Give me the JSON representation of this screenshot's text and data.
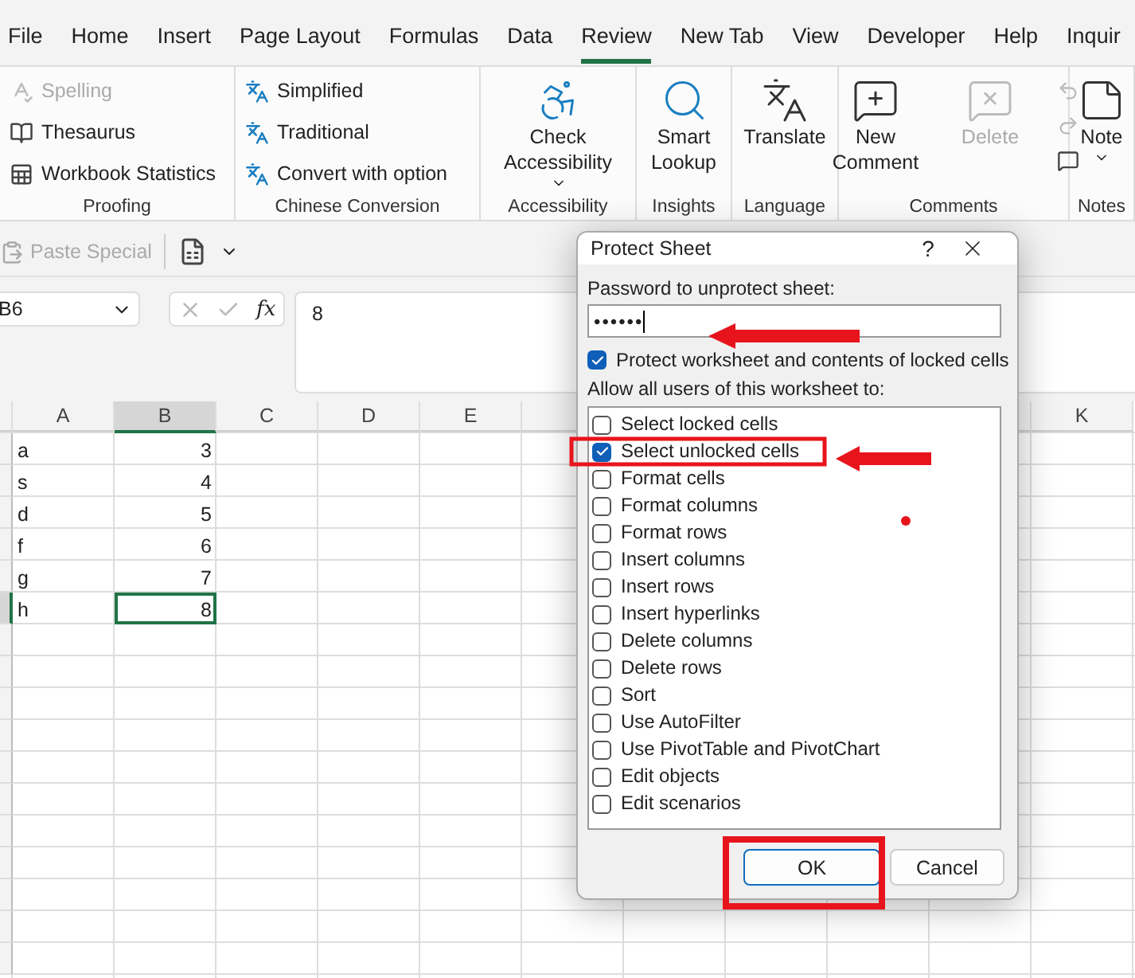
{
  "tabs": [
    {
      "label": "File",
      "selected": false
    },
    {
      "label": "Home",
      "selected": false
    },
    {
      "label": "Insert",
      "selected": false
    },
    {
      "label": "Page Layout",
      "selected": false
    },
    {
      "label": "Formulas",
      "selected": false
    },
    {
      "label": "Data",
      "selected": false
    },
    {
      "label": "Review",
      "selected": true
    },
    {
      "label": "New Tab",
      "selected": false
    },
    {
      "label": "View",
      "selected": false
    },
    {
      "label": "Developer",
      "selected": false
    },
    {
      "label": "Help",
      "selected": false
    },
    {
      "label": "Inquir",
      "selected": false
    }
  ],
  "ribbon": {
    "groups": [
      {
        "name": "Proofing",
        "kind": "list",
        "items": [
          {
            "label": "Spelling",
            "disabled": true
          },
          {
            "label": "Thesaurus",
            "disabled": false
          },
          {
            "label": "Workbook Statistics",
            "disabled": false
          }
        ]
      },
      {
        "name": "Chinese Conversion",
        "kind": "list",
        "items": [
          {
            "label": "Simplified",
            "disabled": false
          },
          {
            "label": "Traditional",
            "disabled": false
          },
          {
            "label": "Convert with option",
            "disabled": false
          }
        ]
      },
      {
        "name": "Accessibility",
        "kind": "large",
        "items": [
          {
            "label": "Check Accessibility",
            "disabled": false,
            "dropdown": true
          }
        ]
      },
      {
        "name": "Insights",
        "kind": "large",
        "items": [
          {
            "label": "Smart Lookup",
            "disabled": false,
            "dropdown": false
          }
        ]
      },
      {
        "name": "Language",
        "kind": "large",
        "items": [
          {
            "label": "Translate",
            "disabled": false,
            "dropdown": false
          }
        ]
      },
      {
        "name": "Comments",
        "kind": "comments",
        "items": [
          {
            "label": "New Comment",
            "disabled": false,
            "dropdown": false
          },
          {
            "label": "Delete",
            "disabled": true,
            "dropdown": false
          }
        ]
      },
      {
        "name": "Notes",
        "kind": "large",
        "items": [
          {
            "label": "Note",
            "disabled": false,
            "dropdown": true
          }
        ]
      }
    ]
  },
  "quick_access": {
    "items": [
      {
        "label": "Paste Special",
        "disabled": true
      }
    ]
  },
  "formula_bar": {
    "name_box": "B6",
    "function_label": "fx",
    "value": "8"
  },
  "grid": {
    "columns": [
      {
        "label": "A",
        "selected": false
      },
      {
        "label": "B",
        "selected": true
      },
      {
        "label": "C",
        "selected": false
      },
      {
        "label": "D",
        "selected": false
      },
      {
        "label": "E",
        "selected": false
      },
      {
        "label": "K",
        "selected": false
      }
    ],
    "rows": [
      {
        "selected": false,
        "cells": [
          {
            "text": "a",
            "selected": false
          },
          {
            "text": "3",
            "selected": false
          }
        ]
      },
      {
        "selected": false,
        "cells": [
          {
            "text": "s",
            "selected": false
          },
          {
            "text": "4",
            "selected": false
          }
        ]
      },
      {
        "selected": false,
        "cells": [
          {
            "text": "d",
            "selected": false
          },
          {
            "text": "5",
            "selected": false
          }
        ]
      },
      {
        "selected": false,
        "cells": [
          {
            "text": "f",
            "selected": false
          },
          {
            "text": "6",
            "selected": false
          }
        ]
      },
      {
        "selected": false,
        "cells": [
          {
            "text": "g",
            "selected": false
          },
          {
            "text": "7",
            "selected": false
          }
        ]
      },
      {
        "selected": true,
        "cells": [
          {
            "text": "h",
            "selected": false
          },
          {
            "text": "8",
            "selected": true
          }
        ]
      }
    ]
  },
  "dialog": {
    "title": "Protect Sheet",
    "help": "?",
    "password_label": "Password to unprotect sheet:",
    "password": "••••••",
    "protect": {
      "label": "Protect worksheet and contents of locked cells",
      "checked": true
    },
    "allow_label": "Allow all users of this worksheet to:",
    "permissions": [
      {
        "label": "Select locked cells",
        "checked": false
      },
      {
        "label": "Select unlocked cells",
        "checked": true
      },
      {
        "label": "Format cells",
        "checked": false
      },
      {
        "label": "Format columns",
        "checked": false
      },
      {
        "label": "Format rows",
        "checked": false
      },
      {
        "label": "Insert columns",
        "checked": false
      },
      {
        "label": "Insert rows",
        "checked": false
      },
      {
        "label": "Insert hyperlinks",
        "checked": false
      },
      {
        "label": "Delete columns",
        "checked": false
      },
      {
        "label": "Delete rows",
        "checked": false
      },
      {
        "label": "Sort",
        "checked": false
      },
      {
        "label": "Use AutoFilter",
        "checked": false
      },
      {
        "label": "Use PivotTable and PivotChart",
        "checked": false
      },
      {
        "label": "Edit objects",
        "checked": false
      },
      {
        "label": "Edit scenarios",
        "checked": false
      }
    ],
    "buttons": [
      {
        "label": "OK",
        "default": true
      },
      {
        "label": "Cancel",
        "default": false
      }
    ]
  }
}
